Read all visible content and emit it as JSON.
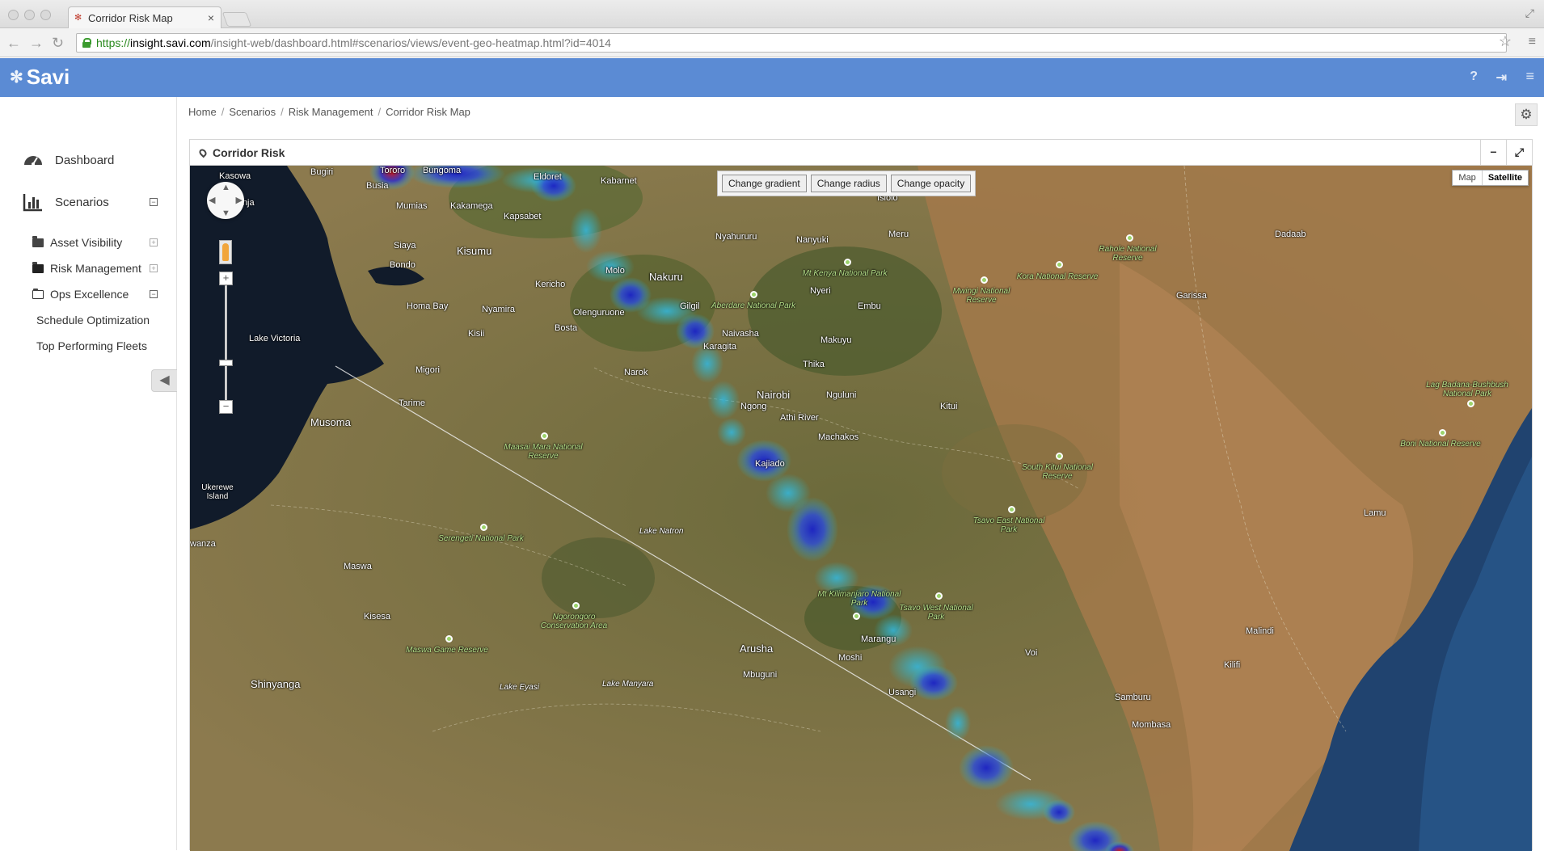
{
  "browser": {
    "tab_title": "Corridor Risk Map",
    "close": "×",
    "url_scheme": "https://",
    "url_host": "insight.savi.com",
    "url_path": "/insight-web/dashboard.html#scenarios/views/event-geo-heatmap.html?id=4014"
  },
  "header": {
    "brand": "Savi",
    "help": "?",
    "logout_icon": "logout-icon",
    "menu_icon": "menu-icon"
  },
  "sidebar": {
    "dashboard": "Dashboard",
    "scenarios": "Scenarios",
    "asset_visibility": "Asset Visibility",
    "risk_management": "Risk Management",
    "ops_excellence": "Ops Excellence",
    "schedule_optimization": "Schedule Optimization",
    "top_performing_fleets": "Top Performing Fleets",
    "expander_collapsed": "+",
    "expander_expanded": "−"
  },
  "breadcrumb": [
    "Home",
    "Scenarios",
    "Risk Management",
    "Corridor Risk Map"
  ],
  "breadcrumb_sep": "/",
  "panel": {
    "title": "Corridor Risk",
    "minimize": "−",
    "maximize": "⤢"
  },
  "map": {
    "buttons": {
      "gradient": "Change gradient",
      "radius": "Change radius",
      "opacity": "Change opacity"
    },
    "map_type": {
      "map": "Map",
      "satellite": "Satellite",
      "selected": "Satellite"
    },
    "labels": {
      "kasowa": "Kasowa",
      "bugiri": "Bugiri",
      "tororo": "Tororo",
      "bungoma": "Bungoma",
      "eldoret": "Eldoret",
      "kabarnet": "Kabarnet",
      "isiolo": "Isiolo",
      "busia": "Busia",
      "jinja": "Jinja",
      "mumias": "Mumias",
      "kakamega": "Kakamega",
      "kapsabet": "Kapsabet",
      "nyahururu": "Nyahururu",
      "nanyuki": "Nanyuki",
      "meru": "Meru",
      "dadaab": "Dadaab",
      "siaya": "Siaya",
      "kisumu": "Kisumu",
      "bondo": "Bondo",
      "molo": "Molo",
      "nakuru": "Nakuru",
      "kericho": "Kericho",
      "nyeri": "Nyeri",
      "garissa": "Garissa",
      "homa_bay": "Homa Bay",
      "nyamira": "Nyamira",
      "olenguruone": "Olenguruone",
      "gilgil": "Gilgil",
      "embu": "Embu",
      "kisii": "Kisii",
      "bosta": "Bosta",
      "naivasha": "Naivasha",
      "makuyu": "Makuyu",
      "lake_victoria": "Lake Victoria",
      "karagita": "Karagita",
      "migori": "Migori",
      "narok": "Narok",
      "thika": "Thika",
      "nairobi": "Nairobi",
      "ngong": "Ngong",
      "nguluni": "Nguluni",
      "kitui": "Kitui",
      "tarime": "Tarime",
      "athi_river": "Athi River",
      "musoma": "Musoma",
      "machakos": "Machakos",
      "kajiado": "Kajiado",
      "ukerewe": "Ukerewe Island",
      "lamu": "Lamu",
      "lake_natron": "Lake Natron",
      "wanza": "wanza",
      "maswa": "Maswa",
      "kisesa": "Kisesa",
      "arusha": "Arusha",
      "moshi": "Moshi",
      "marangu": "Marangu",
      "malindi": "Malindi",
      "voi": "Voi",
      "kilifi": "Kilifi",
      "shinyanga": "Shinyanga",
      "mbuguni": "Mbuguni",
      "usangi": "Usangi",
      "samburu": "Samburu",
      "lake_eyasi": "Lake Eyasi",
      "lake_manyara": "Lake Manyara",
      "mombasa": "Mombasa"
    },
    "parks": {
      "rahole": "Rahole National Reserve",
      "mt_kenya": "Mt Kenya National Park",
      "kora": "Kora National Reserve",
      "mwingi": "Mwingi National Reserve",
      "aberdare": "Aberdare National Park",
      "lag_badana": "Lag Badana-Bushbush National Park",
      "boni": "Boni National Reserve",
      "maasai_mara": "Maasai Mara National Reserve",
      "south_kitui": "South Kitui National Reserve",
      "tsavo_east": "Tsavo East National Park",
      "serengeti": "Serengeti National Park",
      "kilimanjaro": "Mt Kilimanjaro National Park",
      "tsavo_west": "Tsavo West National Park",
      "ngorongoro": "Ngorongoro Conservation Area",
      "maswa_game": "Maswa Game Reserve"
    },
    "colors": {
      "heat_low": "#27c3d8",
      "heat_mid": "#2222cc",
      "heat_high": "#d01818",
      "accent": "#5b8bd4"
    }
  }
}
